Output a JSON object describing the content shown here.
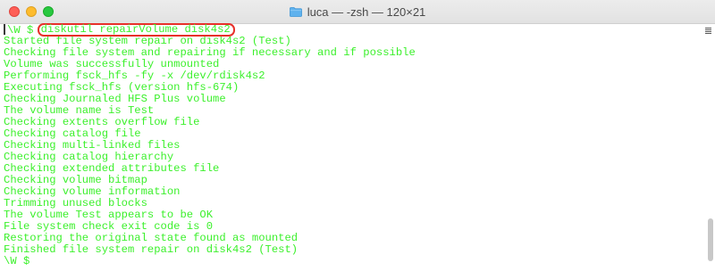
{
  "window": {
    "title": "luca — -zsh — 120×21",
    "folder_icon": "folder-icon"
  },
  "colors": {
    "text": "#3cf02c",
    "highlight": "#e8302a",
    "background": "#ffffff"
  },
  "terminal": {
    "prompt": "\\W $",
    "command": "diskutil repairVolume disk4s2",
    "output": [
      "Started file system repair on disk4s2 (Test)",
      "Checking file system and repairing if necessary and if possible",
      "Volume was successfully unmounted",
      "Performing fsck_hfs -fy -x /dev/rdisk4s2",
      "Executing fsck_hfs (version hfs-674)",
      "Checking Journaled HFS Plus volume",
      "The volume name is Test",
      "Checking extents overflow file",
      "Checking catalog file",
      "Checking multi-linked files",
      "Checking catalog hierarchy",
      "Checking extended attributes file",
      "Checking volume bitmap",
      "Checking volume information",
      "Trimming unused blocks",
      "The volume Test appears to be OK",
      "File system check exit code is 0",
      "Restoring the original state found as mounted",
      "Finished file system repair on disk4s2 (Test)"
    ],
    "final_prompt": "\\W $"
  }
}
